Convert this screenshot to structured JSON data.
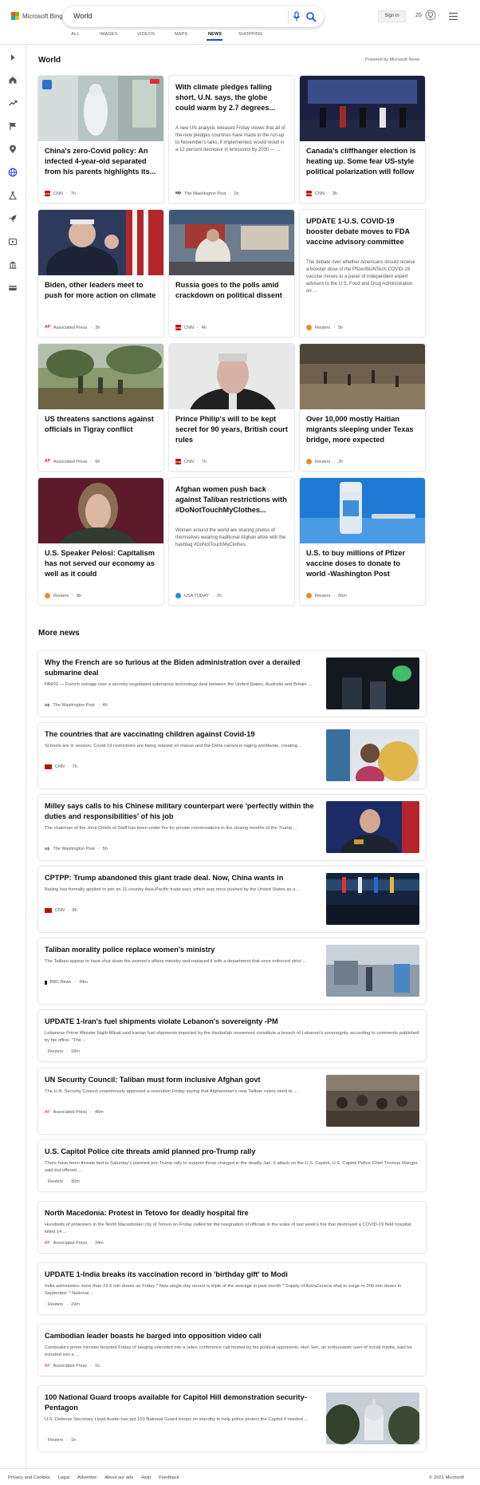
{
  "header": {
    "brand": "Microsoft Bing",
    "query": "World",
    "sign_in": "Sign in",
    "points": "20",
    "tabs": [
      "ALL",
      "IMAGES",
      "VIDEOS",
      "MAPS",
      "NEWS",
      "SHOPPING"
    ],
    "active_tab": "NEWS",
    "accent": "#174ae4"
  },
  "rail": {
    "icons": [
      "expand-icon",
      "home-icon",
      "trending-icon",
      "flag-icon",
      "location-icon",
      "globe-icon",
      "science-icon",
      "rocket-icon",
      "entertainment-icon",
      "politics-icon",
      "money-icon"
    ]
  },
  "world": {
    "title": "World",
    "powered": "Powered by Microsoft News",
    "cards": [
      {
        "title": "China's zero-Covid policy: An infected 4-year-old separated from his parents highlights its...",
        "snippet": "",
        "source": "CNN",
        "time": "7h",
        "has_image": true,
        "image": "hospital-corridor-image"
      },
      {
        "title": "With climate pledges falling short, U.N. says, the globe could warm by 2.7 degrees...",
        "snippet": "A new UN analysis released Friday shows that all of the new pledges countries have made in the run-up to November's talks, if implemented, would result in a 12 percent decrease in emissions by 2030 — ...",
        "source": "The Washington Post",
        "time": "1h",
        "has_image": false
      },
      {
        "title": "Canada's cliffhanger election is heating up. Some fear US-style political polarization will follow",
        "snippet": "",
        "source": "CNN",
        "time": "3h",
        "has_image": true,
        "image": "debate-stage-image"
      },
      {
        "title": "Biden, other leaders meet to push for more action on climate",
        "snippet": "",
        "source": "Associated Press",
        "time": "3h",
        "has_image": true,
        "image": "biden-image"
      },
      {
        "title": "Russia goes to the polls amid crackdown on political dissent",
        "snippet": "",
        "source": "CNN",
        "time": "4h",
        "has_image": true,
        "image": "polling-station-image"
      },
      {
        "title": "UPDATE 1-U.S. COVID-19 booster debate moves to FDA vaccine advisory committee",
        "snippet": "The debate over whether Americans should receive a booster dose of the Pfizer/BioNTech COVID-19 vaccine moves to a panel of independent expert advisers to the U.S. Food and Drug Administration on ...",
        "source": "Reuters",
        "time": "5h",
        "has_image": false
      },
      {
        "title": "US threatens sanctions against officials in Tigray conflict",
        "snippet": "",
        "source": "Associated Press",
        "time": "6h",
        "has_image": true,
        "image": "soldiers-field-image"
      },
      {
        "title": "Prince Philip's will to be kept secret for 90 years, British court rules",
        "snippet": "",
        "source": "CNN",
        "time": "7h",
        "has_image": true,
        "image": "prince-philip-image"
      },
      {
        "title": "Over 10,000 mostly Haitian migrants sleeping under Texas bridge, more expected",
        "snippet": "",
        "source": "Reuters",
        "time": "2h",
        "has_image": true,
        "image": "migrants-river-image"
      },
      {
        "title": "U.S. Speaker Pelosi: Capitalism has not served our economy as well as it could",
        "snippet": "",
        "source": "Reuters",
        "time": "8h",
        "has_image": true,
        "image": "pelosi-image"
      },
      {
        "title": "Afghan women push back against Taliban restrictions with #DoNotTouchMyClothes...",
        "snippet": "Women around the world are sharing photos of themselves wearing traditional Afghan attire with the hashtag #DoNotTouchMyClothes.",
        "source": "USA TODAY",
        "time": "1h",
        "has_image": false
      },
      {
        "title": "U.S. to buy millions of Pfizer vaccine doses to donate to world -Washington Post",
        "snippet": "",
        "source": "Reuters",
        "time": "56m",
        "has_image": true,
        "image": "vaccine-vial-image"
      }
    ]
  },
  "more_news": {
    "title": "More news",
    "items": [
      {
        "title": "Why the French are so furious at the Biden administration over a derailed submarine deal",
        "snippet": "PARIS — French outrage over a secretly negotiated submarine technology deal between the United States, Australia and Britain ...",
        "source": "The Washington Post",
        "time": "4h",
        "has_image": true
      },
      {
        "title": "The countries that are vaccinating children against Covid-19",
        "snippet": "Schools are in session, Covid-19 restrictions are being relaxed en masse and the Delta variant is raging worldwide, creating ...",
        "source": "CNN",
        "time": "7h",
        "has_image": true
      },
      {
        "title": "Milley says calls to his Chinese military counterpart were 'perfectly within the duties and responsibilities' of his job",
        "snippet": "The chairman of the Joint Chiefs of Staff has been under fire for private conversations in the closing months of the Trump ...",
        "source": "The Washington Post",
        "time": "5h",
        "has_image": true
      },
      {
        "title": "CPTPP: Trump abandoned this giant trade deal. Now, China wants in",
        "snippet": "Beijing has formally applied to join an 11-country Asia-Pacific trade pact, which was once pushed by the United States as a ...",
        "source": "CNN",
        "time": "8h",
        "has_image": true
      },
      {
        "title": "Taliban morality police replace women's ministry",
        "snippet": "The Taliban appear to have shut down the women's affairs ministry and replaced it with a department that once enforced strict ...",
        "source": "BBC News",
        "time": "34m",
        "has_image": true
      },
      {
        "title": "UPDATE 1-Iran's fuel shipments violate Lebanon's sovereignty -PM",
        "snippet": "Lebanese Prime Minister Najib Mikati said Iranian fuel shipments imported by the Hezbollah movement constitute a breach of Lebanon's sovereignty, according to comments published by his office. \"The ...",
        "source": "Reuters",
        "time": "18m",
        "has_image": false
      },
      {
        "title": "UN Security Council: Taliban must form inclusive Afghan govt",
        "snippet": "The U.N. Security Council unanimously approved a resolution Friday saying that Afghanistan's new Taliban rulers need to ...",
        "source": "Associated Press",
        "time": "46m",
        "has_image": true
      },
      {
        "title": "U.S. Capitol Police cite threats amid planned pro-Trump rally",
        "snippet": "There have been threats tied to Saturday's planned pro-Trump rally to support those charged in the deadly Jan. 6 attack on the U.S. Capitol, U.S. Capitol Police Chief Thomas Manger said but offered ...",
        "source": "Reuters",
        "time": "30m",
        "has_image": false
      },
      {
        "title": "North Macedonia: Protest in Tetovo for deadly hospital fire",
        "snippet": "Hundreds of protesters in the North Macedonian city of Tetovo on Friday called for the resignation of officials in the wake of last week's fire that destroyed a COVID-19 field hospital, killed 14 ...",
        "source": "Associated Press",
        "time": "34m",
        "has_image": false
      },
      {
        "title": "UPDATE 1-India breaks its vaccination record in 'birthday gift' to Modi",
        "snippet": "India administers more than 22.6 mln doses on Friday * New single-day record is triple of the average in past month * Supply of AstraZeneca shot to surge to 200 mln doses in September * National ...",
        "source": "Reuters",
        "time": "29m",
        "has_image": false
      },
      {
        "title": "Cambodian leader boasts he barged into opposition video call",
        "snippet": "Cambodia's prime minister boasted Friday of barging uninvited into a video conference call hosted by his political opponents. Hun Sen, an enthusiastic user of social media, said he intruded into a ...",
        "source": "Associated Press",
        "time": "1h",
        "has_image": false
      },
      {
        "title": "100 National Guard troops available for Capitol Hill demonstration security-Pentagon",
        "snippet": "U.S. Defense Secretary Lloyd Austin has put 100 National Guard troops on standby to help police protect the Capitol if needed ...",
        "source": "Reuters",
        "time": "1h",
        "has_image": true
      }
    ]
  },
  "footer": {
    "links": [
      "Privacy and Cookies",
      "Legal",
      "Advertise",
      "About our ads",
      "Help",
      "Feedback"
    ],
    "copyright": "© 2021 Microsoft"
  },
  "source_colors": {
    "CNN": "#cc0000",
    "The Washington Post": "#222222",
    "Associated Press": "#e0201b",
    "Reuters": "#f08a24",
    "USA TODAY": "#1a8fe3",
    "BBC News": "#111111"
  }
}
